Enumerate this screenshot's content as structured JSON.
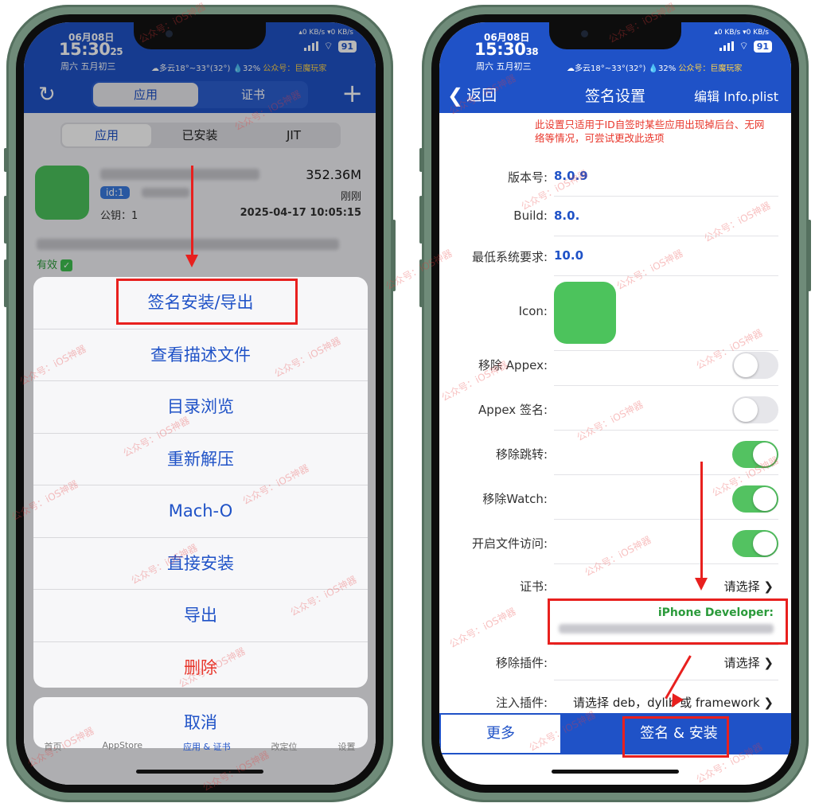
{
  "status_left": {
    "date": "06月08日",
    "time": "15:30",
    "seconds": "25",
    "lunar": "周六 五月初三",
    "speed": "▴0 KB/s ▾0 KB/s",
    "battery": "91",
    "weather": "☁多云18°~33°(32°) 💧32%",
    "account": "公众号：巨魔玩家"
  },
  "status_right": {
    "date": "06月08日",
    "time": "15:30",
    "seconds": "38",
    "lunar": "周六 五月初三",
    "speed": "▴0 KB/s ▾0 KB/s",
    "battery": "91",
    "weather": "☁多云18°~33°(32°) 💧32%",
    "account": "公众号：巨魔玩家"
  },
  "left": {
    "top_tabs": [
      "应用",
      "证书"
    ],
    "filter_tabs": [
      "应用",
      "已安装",
      "JIT"
    ],
    "app": {
      "size": "352.36M",
      "id_badge": "id:1",
      "time_rel": "刚刚",
      "pubkey": "公钥：1",
      "timestamp": "2025-04-17 10:05:15",
      "valid": "有效"
    },
    "sheet_items": [
      "签名安装/导出",
      "查看描述文件",
      "目录浏览",
      "重新解压",
      "Mach-O",
      "直接安装",
      "导出",
      "删除"
    ],
    "cancel": "取消",
    "tabs": [
      "首页",
      "AppStore",
      "应用 & 证书",
      "改定位",
      "设置"
    ]
  },
  "right": {
    "back": "返回",
    "title": "签名设置",
    "edit": "编辑 Info.plist",
    "note": "此设置只适用于ID自签时某些应用出现掉后台、无网络等情况，可尝试更改此选项",
    "version_label": "版本号:",
    "version_value": "8.0.9",
    "build_label": "Build:",
    "build_value": "8.0.",
    "minsys_label": "最低系统要求:",
    "minsys_value": "10.0",
    "icon_label": "Icon:",
    "remove_appex": "移除 Appex:",
    "appex_sign": "Appex 签名:",
    "remove_jump": "移除跳转:",
    "remove_watch": "移除Watch:",
    "file_access": "开启文件访问:",
    "cert_label": "证书:",
    "cert_select": "请选择 ❯",
    "cert_dev": "iPhone Developer:",
    "remove_plugin": "移除插件:",
    "remove_plugin_select": "请选择 ❯",
    "inject_plugin": "注入插件:",
    "inject_select": "请选择 deb，dylib 或 framework ❯",
    "more": "更多",
    "sign_install": "签名 & 安装"
  },
  "watermark": "公众号：iOS神器"
}
